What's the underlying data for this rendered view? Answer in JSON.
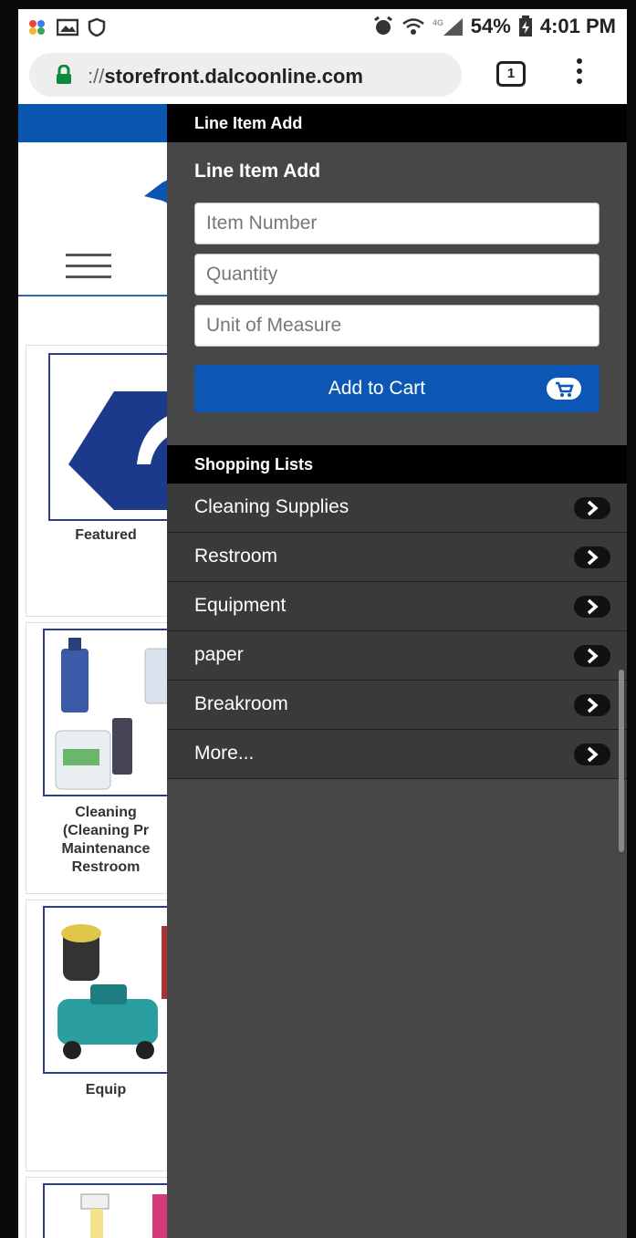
{
  "status_bar": {
    "battery": "54%",
    "time": "4:01 PM"
  },
  "browser": {
    "url_prefix": "://",
    "url_host": "storefront.dalcoonline.com",
    "tab_count": "1"
  },
  "background_page": {
    "cards": [
      {
        "label_lines": [
          "Featured"
        ]
      },
      {
        "label_lines": [
          "Cleaning",
          "(Cleaning Pr",
          "Maintenance",
          "Restroom"
        ]
      },
      {
        "label_lines": [
          "Equip"
        ]
      }
    ]
  },
  "drawer": {
    "header": "Line Item Add",
    "form_title": "Line Item Add",
    "item_number_placeholder": "Item Number",
    "quantity_placeholder": "Quantity",
    "uom_placeholder": "Unit of Measure",
    "add_to_cart_label": "Add to Cart",
    "shopping_lists_header": "Shopping Lists",
    "shopping_lists": [
      {
        "label": "Cleaning Supplies"
      },
      {
        "label": "Restroom"
      },
      {
        "label": "Equipment"
      },
      {
        "label": "paper"
      },
      {
        "label": "Breakroom"
      },
      {
        "label": "More..."
      }
    ]
  },
  "colors": {
    "brand_blue": "#0b57b3",
    "drawer_bg": "#474747",
    "list_bg": "#3a3a3a",
    "header_bg": "#000000"
  }
}
